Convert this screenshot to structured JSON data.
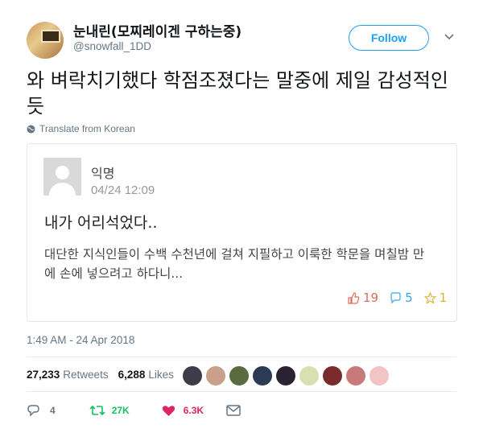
{
  "tweet": {
    "display_name": "눈내린(모찌레이겐 구하는중)",
    "handle": "@snowfall_1DD",
    "follow_label": "Follow",
    "text": "와 벼락치기했다 학점조졌다는 말중에 제일 감성적인듯",
    "translate_label": "Translate from Korean",
    "timestamp": "1:49 AM - 24 Apr 2018"
  },
  "quoted_post": {
    "author": "익명",
    "date": "04/24 12:09",
    "title": "내가 어리석었다..",
    "body": "대단한 지식인들이 수백 수천년에 걸쳐 지필하고 이룩한 학문을 며칠밤 만에 손에 넣으려고 하다니...",
    "likes": "19",
    "comments": "5",
    "scraps": "1"
  },
  "stats": {
    "retweets_count": "27,233",
    "retweets_label": "Retweets",
    "likes_count": "6,288",
    "likes_label": "Likes"
  },
  "likers": [
    "#3d3d4a",
    "#c9a089",
    "#5a6b3f",
    "#2b3a55",
    "#2a2230",
    "#d8e0b0",
    "#7a2c2c",
    "#c87a7a",
    "#f2c4c4"
  ],
  "actions": {
    "reply_count": "4",
    "retweet_count": "27K",
    "like_count": "6.3K"
  },
  "colors": {
    "accent": "#1da1f2",
    "retweet": "#17bf63",
    "like": "#e0245e"
  }
}
